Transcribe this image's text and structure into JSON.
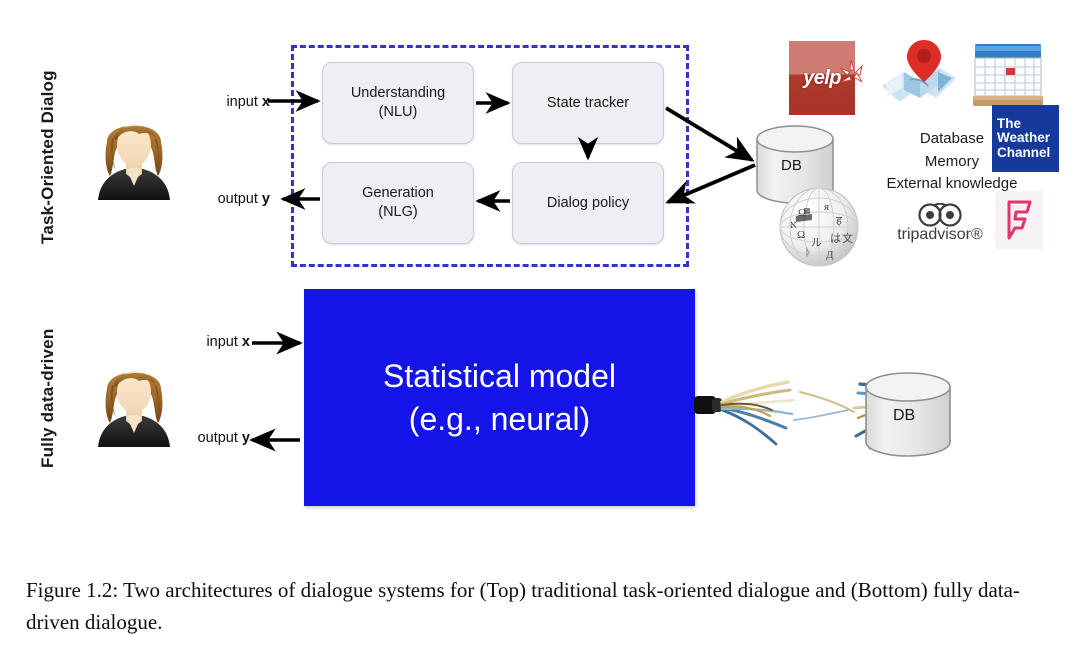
{
  "figure": {
    "sections": [
      {
        "id": "task-oriented",
        "label": "Task-Oriented Dialog"
      },
      {
        "id": "fully-data-driven",
        "label": "Fully data-driven"
      }
    ],
    "io": {
      "input_prefix": "input ",
      "input_var": "x",
      "output_prefix": "output ",
      "output_var": "y"
    },
    "pipeline": {
      "boxes": [
        {
          "id": "nlu",
          "line1": "Understanding",
          "line2": "(NLU)"
        },
        {
          "id": "state",
          "line1": "State tracker",
          "line2": ""
        },
        {
          "id": "nlg",
          "line1": "Generation",
          "line2": "(NLG)"
        },
        {
          "id": "policy",
          "line1": "Dialog policy",
          "line2": ""
        }
      ],
      "dashed_border_color": "#3333cc"
    },
    "model_box": {
      "line1": "Statistical model",
      "line2": "(e.g., neural)",
      "color": "#1414e8",
      "text_color": "#ffffff"
    },
    "database": {
      "top_label": "DB",
      "bottom_label": "DB"
    },
    "knowledge": {
      "lines": [
        "Database",
        "Memory",
        "External knowledge"
      ]
    },
    "logos": [
      {
        "id": "yelp",
        "name": "yelp",
        "text": "yelp"
      },
      {
        "id": "maps",
        "name": "maps-pin",
        "text": ""
      },
      {
        "id": "calendar",
        "name": "calendar",
        "text": ""
      },
      {
        "id": "weather",
        "name": "the-weather-channel",
        "line1": "The",
        "line2": "Weather",
        "line3": "Channel"
      },
      {
        "id": "wikipedia",
        "name": "wikipedia-globe",
        "text": ""
      },
      {
        "id": "tripadvisor",
        "name": "tripadvisor",
        "text": "tripadvisor®"
      },
      {
        "id": "foursquare",
        "name": "foursquare",
        "text": ""
      }
    ]
  },
  "caption": {
    "text": "Figure 1.2: Two architectures of dialogue systems for (Top) traditional task-oriented dialogue and (Bottom) fully data-driven dialogue."
  }
}
